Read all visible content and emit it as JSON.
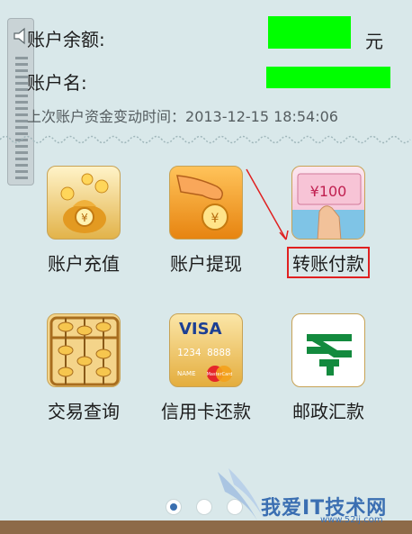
{
  "account": {
    "balance_label": "账户余额:",
    "currency_unit": "元",
    "name_label": "账户名:",
    "last_change_label": "上次账户资金变动时间：",
    "last_change_time": "2013-12-15 18:54:06"
  },
  "tiles": [
    {
      "label": "账户充值",
      "icon": "money-bag-icon"
    },
    {
      "label": "账户提现",
      "icon": "hand-coin-icon"
    },
    {
      "label": "转账付款",
      "icon": "banknote-hand-icon",
      "highlighted": true
    },
    {
      "label": "交易查询",
      "icon": "abacus-icon"
    },
    {
      "label": "信用卡还款",
      "icon": "credit-card-icon",
      "card_brand": "VISA",
      "card_number": "1234 8888",
      "card_name": "NAME",
      "card_logo": "MasterCard"
    },
    {
      "label": "邮政汇款",
      "icon": "china-post-icon"
    }
  ],
  "banknote_value": "¥100",
  "pager": {
    "current": 1,
    "total": 3
  },
  "watermark": {
    "text": "我爱IT技术网",
    "url": "www.52ij.com"
  },
  "colors": {
    "background": "#d9e8ea",
    "mask": "#00ff00",
    "highlight": "#e02020",
    "pager_active": "#3a6fb0"
  }
}
